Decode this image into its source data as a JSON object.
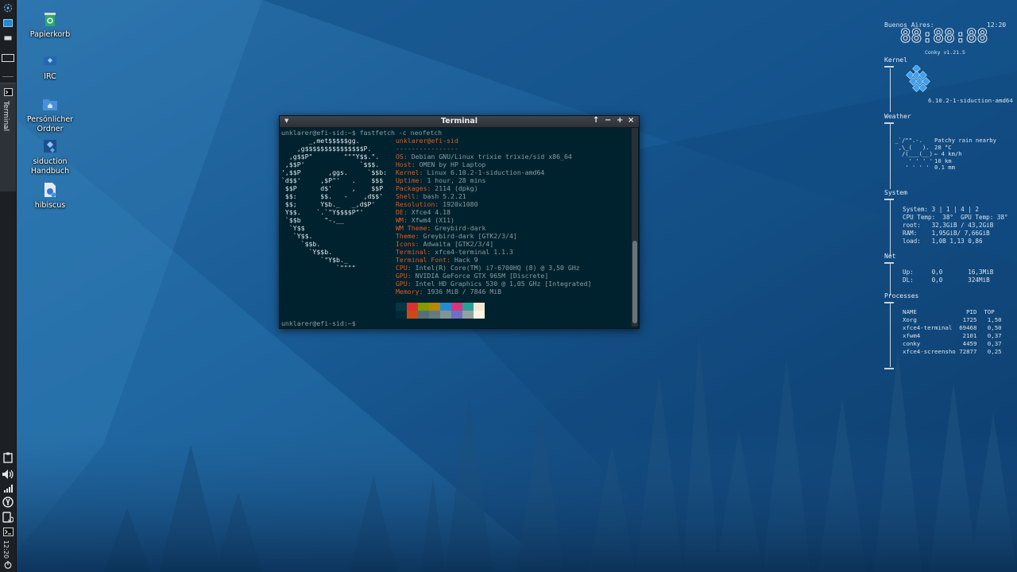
{
  "panel": {
    "clock": "12:20",
    "task_terminal_label": "Terminal"
  },
  "desktop_icons": [
    {
      "label": "Papierkorb"
    },
    {
      "label": "IRC"
    },
    {
      "label": "Persönlicher Ordner"
    },
    {
      "label": "siduction Handbuch"
    },
    {
      "label": "hibiscus"
    }
  ],
  "terminal": {
    "title": "Terminal",
    "command_line": "unklarer@efi-sid:~$ fastfetch -c neofetch",
    "prompt_line": "unklarer@efi-sid:~$",
    "logo_lines": [
      "       _,met$$$$$gg.",
      "    ,g$$$$$$$$$$$$$$$P.",
      "  ,g$$P\"        \"\"\"Y$$.\".",
      " ,$$P'              `$$$.",
      "',$$P       ,ggs.     `$$b:",
      "`d$$'     ,$P\"'   .    $$$",
      " $$P      d$'     ,    $$P",
      " $$:      $$.   -    ,d$$'",
      " $$;      Y$b._   _,d$P'",
      " Y$$.    `.`\"Y$$$$P\"'",
      " `$$b      \"-.__",
      "  `Y$$",
      "   `Y$$.",
      "     `$$b.",
      "       `Y$$b.",
      "          `\"Y$b._",
      "              `\"\"\"\""
    ],
    "user_host": "unklarer@efi-sid",
    "separator": "----------------",
    "info": [
      {
        "key": "OS:",
        "value": " Debian GNU/Linux trixie trixie/sid x86_64"
      },
      {
        "key": "Host:",
        "value": " OMEN by HP Laptop"
      },
      {
        "key": "Kernel:",
        "value": " Linux 6.10.2-1-siduction-amd64"
      },
      {
        "key": "Uptime:",
        "value": " 1 hour, 28 mins"
      },
      {
        "key": "Packages:",
        "value": " 2114 (dpkg)"
      },
      {
        "key": "Shell:",
        "value": " bash 5.2.21"
      },
      {
        "key": "Resolution:",
        "value": " 1920x1080"
      },
      {
        "key": "DE:",
        "value": " Xfce4 4.18"
      },
      {
        "key": "WM:",
        "value": " Xfwm4 (X11)"
      },
      {
        "key": "WM Theme:",
        "value": " Greybird-dark"
      },
      {
        "key": "Theme:",
        "value": " Greybird-dark [GTK2/3/4]"
      },
      {
        "key": "Icons:",
        "value": " Adwaita [GTK2/3/4]"
      },
      {
        "key": "Terminal:",
        "value": " xfce4-terminal 1.1.3"
      },
      {
        "key": "Terminal Font:",
        "value": " Hack 9"
      },
      {
        "key": "CPU:",
        "value": " Intel(R) Core(TM) i7-6700HQ (8) @ 3,50 GHz"
      },
      {
        "key": "GPU:",
        "value": " NVIDIA GeForce GTX 965M [Discrete]"
      },
      {
        "key": "GPU:",
        "value": " Intel HD Graphics 530 @ 1,05 GHz [Integrated]"
      },
      {
        "key": "Memory:",
        "value": " 1936 MiB / 7846 MiB"
      }
    ],
    "swatch_colors_top": [
      "#073642",
      "#dc322f",
      "#859900",
      "#b58900",
      "#268bd2",
      "#d33682",
      "#2aa198",
      "#eee8d5"
    ],
    "swatch_colors_bottom": [
      "#002b36",
      "#cb4b16",
      "#586e75",
      "#657b83",
      "#839496",
      "#6c71c4",
      "#93a1a1",
      "#fdf6e3"
    ]
  },
  "conky": {
    "city": "Buenos Aires:",
    "time_small": "12:20",
    "big_clock": "88:88:88",
    "version": "Conky v1.21.5",
    "kernel_label": "Kernel",
    "kernel_value": "6.10.2-1-siduction-amd64",
    "weather_label": "Weather",
    "weather_art": [
      " _`/\"\".-.",
      "  ,\\_(   ).",
      "   /(___(__)",
      "     ' ' ' '",
      "    ' ' ' '"
    ],
    "weather_values": [
      "Patchy rain nearby",
      "28 °C",
      "← 4 km/h",
      "10 km",
      "0.1 mm"
    ],
    "system_label": "System",
    "system_lines": [
      "System: 3 | 1 | 4 | 2",
      "CPU Temp:  38°  GPU Temp: 38°",
      "root:   32,3GiB / 43,2GiB",
      "RAM:    1,95GiB/ 7,66GiB",
      "load:   1,08 1,13 0,86"
    ],
    "net_label": "Net",
    "net_lines": [
      "Up:     0,0       16,3MiB",
      "DL:     0,0       324MiB"
    ],
    "processes_label": "Processes",
    "process_header": "NAME              PID  TOP",
    "processes": [
      "Xorg             1725   1,50",
      "xfce4-terminal  69468   0,50",
      "xfwm4            2101   0,37",
      "conky            4459   0,37",
      "xfce4-screensho 72877   0,25"
    ]
  }
}
